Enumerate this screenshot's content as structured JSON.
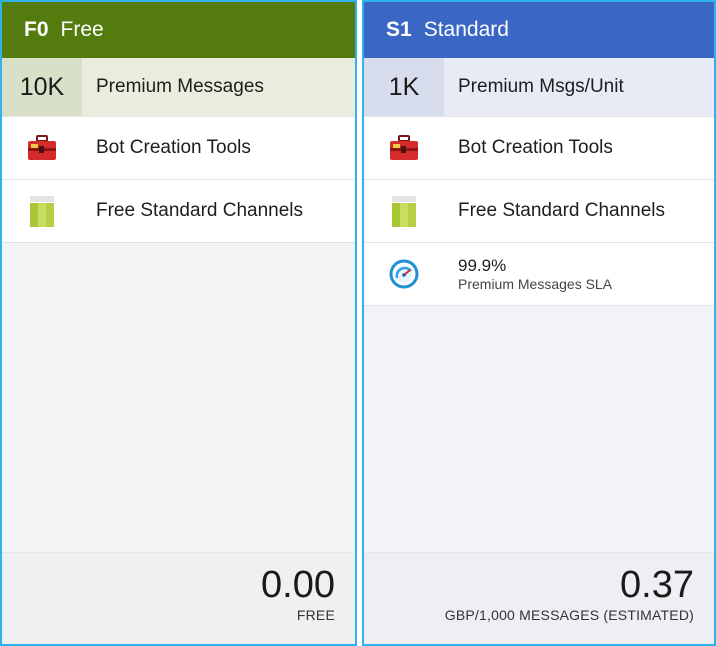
{
  "cards": [
    {
      "tier_code": "F0",
      "tier_name": "Free",
      "hero_value": "10K",
      "hero_label": "Premium Messages",
      "features": [
        {
          "icon": "toolbox-icon",
          "label": "Bot Creation Tools"
        },
        {
          "icon": "channels-icon",
          "label": "Free Standard Channels"
        }
      ],
      "price": "0.00",
      "price_unit": "FREE",
      "header_color": "#547b0e"
    },
    {
      "tier_code": "S1",
      "tier_name": "Standard",
      "hero_value": "1K",
      "hero_label": "Premium Msgs/Unit",
      "features": [
        {
          "icon": "toolbox-icon",
          "label": "Bot Creation Tools"
        },
        {
          "icon": "channels-icon",
          "label": "Free Standard Channels"
        }
      ],
      "sla": {
        "icon": "speedometer-icon",
        "value": "99.9%",
        "label": "Premium Messages SLA"
      },
      "price": "0.37",
      "price_unit": "GBP/1,000 MESSAGES (ESTIMATED)",
      "header_color": "#3a66c4"
    }
  ],
  "selection_border_color": "#2fb3ea"
}
